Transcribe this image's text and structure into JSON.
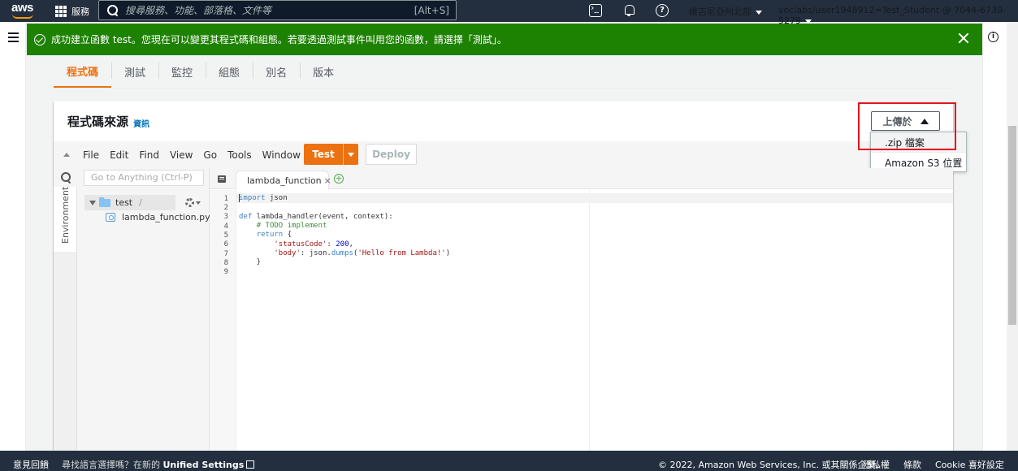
{
  "topnav": {
    "logo_text": "aws",
    "services_label": "服務",
    "search_placeholder": "搜尋服務、功能、部落格、文件等",
    "search_shortcut": "[Alt+S]",
    "help_glyph": "?",
    "region": "維吉尼亞州北部",
    "account": "voclabs/user1948912=Test_Student @ 7044-6739-5279"
  },
  "flash": {
    "message": "成功建立函數 test。您現在可以變更其程式碼和組態。若要透過測試事件叫用您的函數，請選擇「測試」。",
    "type": "success"
  },
  "info_rail_glyph": "i",
  "tabs": [
    {
      "label": "程式碼",
      "active": true
    },
    {
      "label": "測試",
      "active": false
    },
    {
      "label": "監控",
      "active": false
    },
    {
      "label": "組態",
      "active": false
    },
    {
      "label": "別名",
      "active": false
    },
    {
      "label": "版本",
      "active": false
    }
  ],
  "panel": {
    "title": "程式碼來源",
    "info_link": "資訊"
  },
  "upload": {
    "button_label": "上傳於",
    "options": [
      ".zip 檔案",
      "Amazon S3 位置"
    ]
  },
  "ide": {
    "menu": [
      "File",
      "Edit",
      "Find",
      "View",
      "Go",
      "Tools",
      "Window"
    ],
    "test_label": "Test",
    "deploy_label": "Deploy",
    "goto_placeholder": "Go to Anything (Ctrl-P)",
    "environment_label": "Environment",
    "folder_name": "test",
    "folder_suffix": "/",
    "file_name": "lambda_function.py",
    "open_tab": "lambda_function",
    "tab_close": "×",
    "add_tab": "+"
  },
  "code": {
    "line_numbers": [
      "1",
      "2",
      "3",
      "4",
      "5",
      "6",
      "7",
      "8",
      "9"
    ]
  },
  "colors": {
    "nav_bg": "#232f3e",
    "success": "#1d8102",
    "accent": "#ec7211",
    "highlight_box": "#e0141e"
  },
  "footer": {
    "feedback": "意見回饋",
    "language_prompt": "尋找語言選擇嗎？在新的",
    "unified_settings": "Unified Settings",
    "copyright": "© 2022, Amazon Web Services, Inc. 或其關係企業。",
    "privacy": "隱私權",
    "terms": "條款",
    "cookie": "Cookie 喜好設定"
  }
}
